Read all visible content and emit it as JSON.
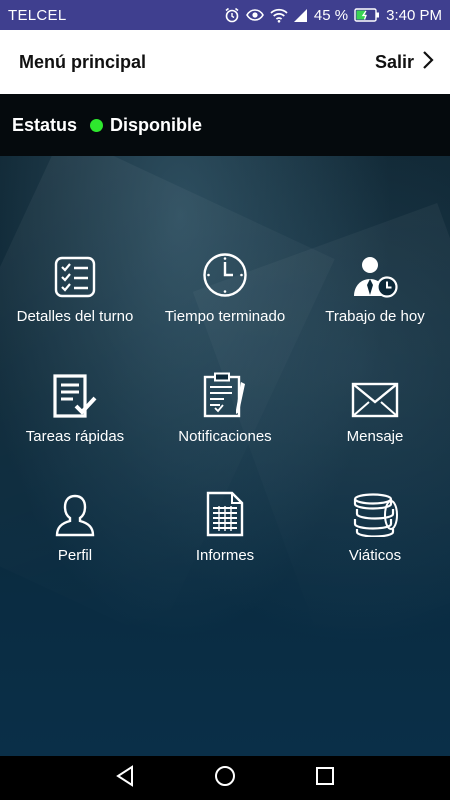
{
  "status_bar": {
    "carrier": "TELCEL",
    "battery": "45 %",
    "time": "3:40 PM"
  },
  "header": {
    "title": "Menú principal",
    "exit_label": "Salir"
  },
  "availability": {
    "label": "Estatus",
    "value": "Disponible",
    "color": "#2ee82e"
  },
  "menu": [
    {
      "label": "Detalles del turno",
      "icon": "checklist-icon"
    },
    {
      "label": "Tiempo terminado",
      "icon": "clock-icon"
    },
    {
      "label": "Trabajo de hoy",
      "icon": "worker-clock-icon"
    },
    {
      "label": "Tareas rápidas",
      "icon": "quick-task-icon"
    },
    {
      "label": "Notificaciones",
      "icon": "clipboard-icon"
    },
    {
      "label": "Mensaje",
      "icon": "envelope-icon"
    },
    {
      "label": "Perfil",
      "icon": "person-icon"
    },
    {
      "label": "Informes",
      "icon": "report-icon"
    },
    {
      "label": "Viáticos",
      "icon": "coins-icon"
    }
  ],
  "colors": {
    "header_bg": "#ffffff",
    "status_bar_bg": "#3f3f8f",
    "main_bg": "#0c2838"
  }
}
